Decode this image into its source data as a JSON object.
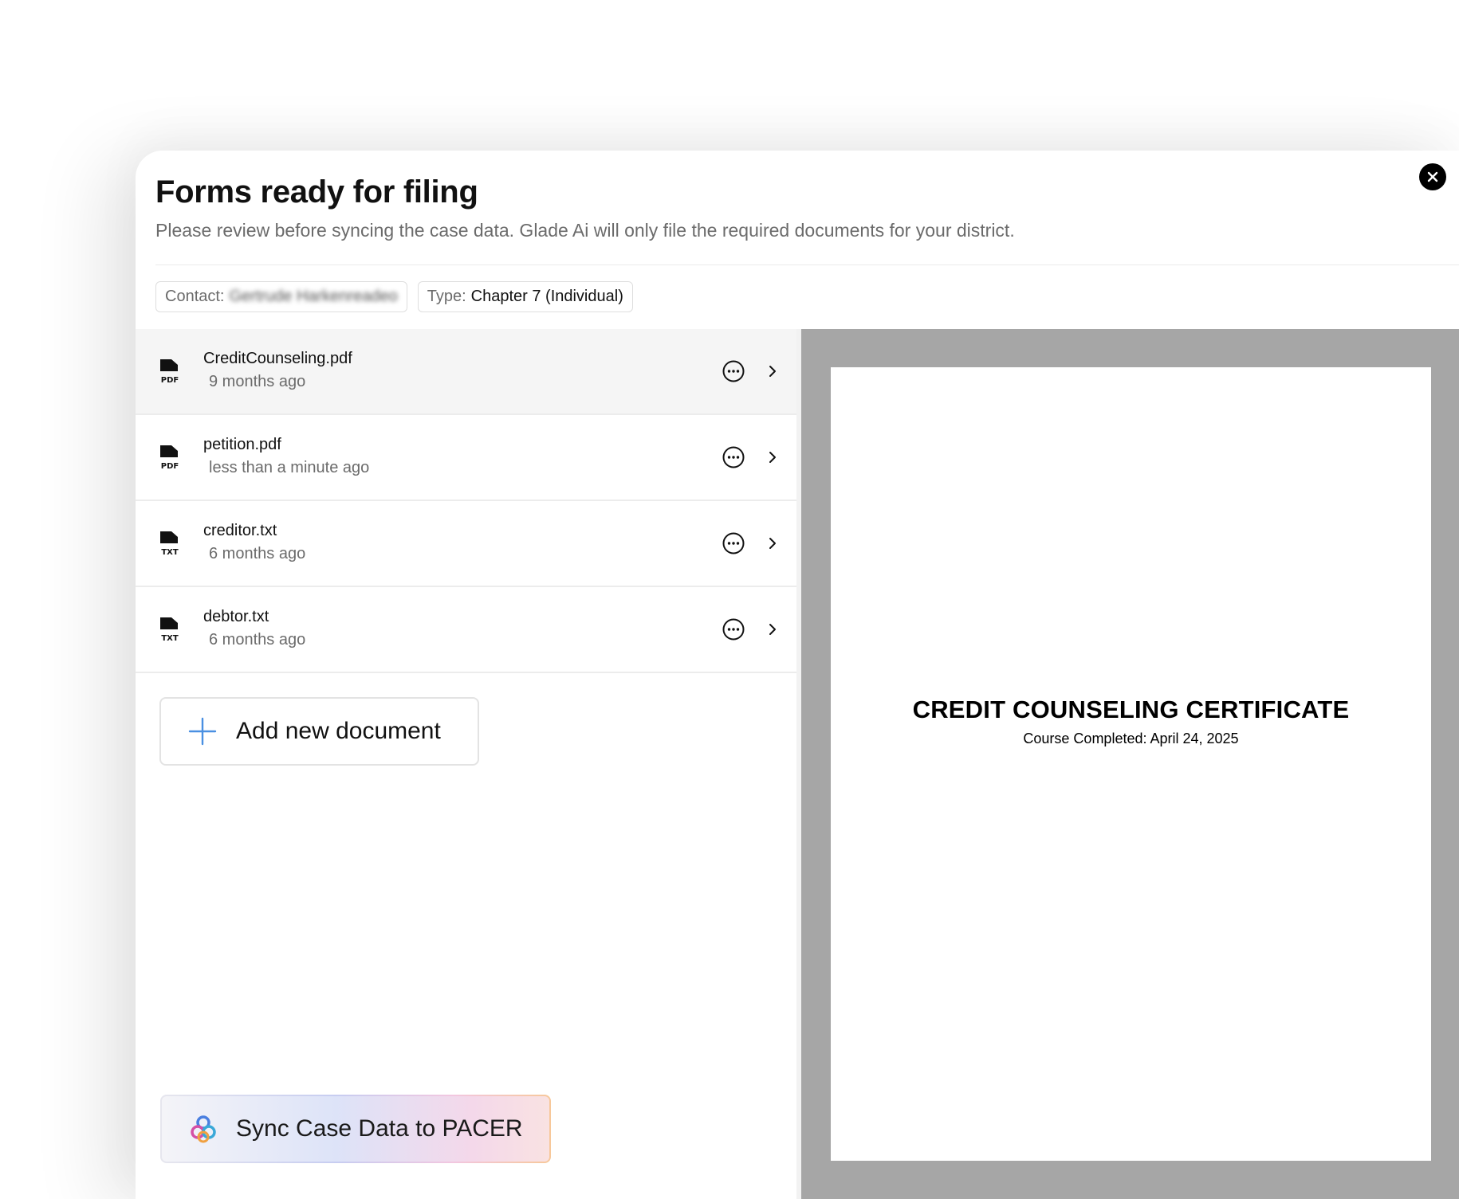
{
  "modal": {
    "title": "Forms ready for filing",
    "subtitle": "Please review before syncing the case data. Glade Ai will only file the required documents for your district.",
    "close_icon": "close-icon"
  },
  "chips": {
    "contact_label": "Contact:",
    "contact_value": "Gertrude Harkenreadeo",
    "type_label": "Type:",
    "type_value": "Chapter 7 (Individual)"
  },
  "documents": [
    {
      "name": "CreditCounseling.pdf",
      "time": "9 months ago",
      "type": "PDF",
      "selected": true
    },
    {
      "name": "petition.pdf",
      "time": "less than a minute ago",
      "type": "PDF",
      "selected": false
    },
    {
      "name": "creditor.txt",
      "time": "6 months ago",
      "type": "TXT",
      "selected": false
    },
    {
      "name": "debtor.txt",
      "time": "6 months ago",
      "type": "TXT",
      "selected": false
    }
  ],
  "actions": {
    "add_label": "Add new document",
    "sync_label": "Sync Case Data to PACER"
  },
  "preview": {
    "doc_title": "CREDIT COUNSELING CERTIFICATE",
    "doc_subtitle": "Course Completed: April 24, 2025"
  },
  "colors": {
    "accent_blue": "#4a90e2",
    "preview_bg": "#a6a6a6",
    "selected_row": "#f5f5f5"
  }
}
